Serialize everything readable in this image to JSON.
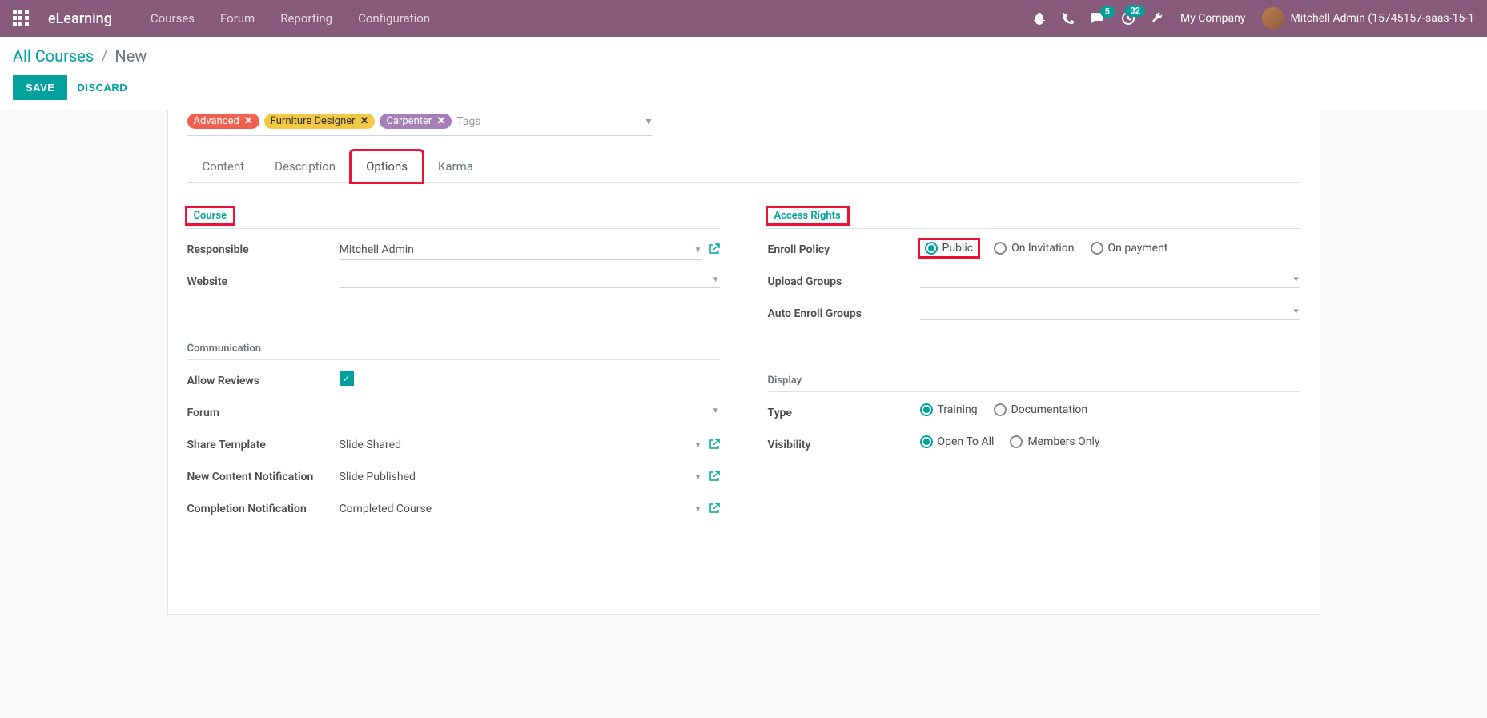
{
  "navbar": {
    "app_name": "eLearning",
    "menu": [
      "Courses",
      "Forum",
      "Reporting",
      "Configuration"
    ],
    "badges": {
      "messages": "5",
      "activities": "32"
    },
    "company": "My Company",
    "user": "Mitchell Admin (15745157-saas-15-1"
  },
  "breadcrumb": {
    "parent": "All Courses",
    "current": "New"
  },
  "actions": {
    "save": "SAVE",
    "discard": "DISCARD"
  },
  "tags": {
    "items": [
      {
        "label": "Advanced",
        "color": "orange"
      },
      {
        "label": "Furniture Designer",
        "color": "yellow"
      },
      {
        "label": "Carpenter",
        "color": "purple"
      }
    ],
    "placeholder": "Tags"
  },
  "tabs": [
    "Content",
    "Description",
    "Options",
    "Karma"
  ],
  "active_tab": "Options",
  "left": {
    "course": {
      "header": "Course",
      "responsible": {
        "label": "Responsible",
        "value": "Mitchell Admin"
      },
      "website": {
        "label": "Website",
        "value": ""
      }
    },
    "communication": {
      "header": "Communication",
      "allow_reviews": {
        "label": "Allow Reviews",
        "checked": true
      },
      "forum": {
        "label": "Forum",
        "value": ""
      },
      "share_template": {
        "label": "Share Template",
        "value": "Slide Shared"
      },
      "new_content": {
        "label": "New Content Notification",
        "value": "Slide Published"
      },
      "completion": {
        "label": "Completion Notification",
        "value": "Completed Course"
      }
    }
  },
  "right": {
    "access": {
      "header": "Access Rights",
      "enroll_policy": {
        "label": "Enroll Policy",
        "options": [
          "Public",
          "On Invitation",
          "On payment"
        ],
        "selected": "Public"
      },
      "upload_groups": {
        "label": "Upload Groups",
        "value": ""
      },
      "auto_enroll": {
        "label": "Auto Enroll Groups",
        "value": ""
      }
    },
    "display": {
      "header": "Display",
      "type": {
        "label": "Type",
        "options": [
          "Training",
          "Documentation"
        ],
        "selected": "Training"
      },
      "visibility": {
        "label": "Visibility",
        "options": [
          "Open To All",
          "Members Only"
        ],
        "selected": "Open To All"
      }
    }
  }
}
